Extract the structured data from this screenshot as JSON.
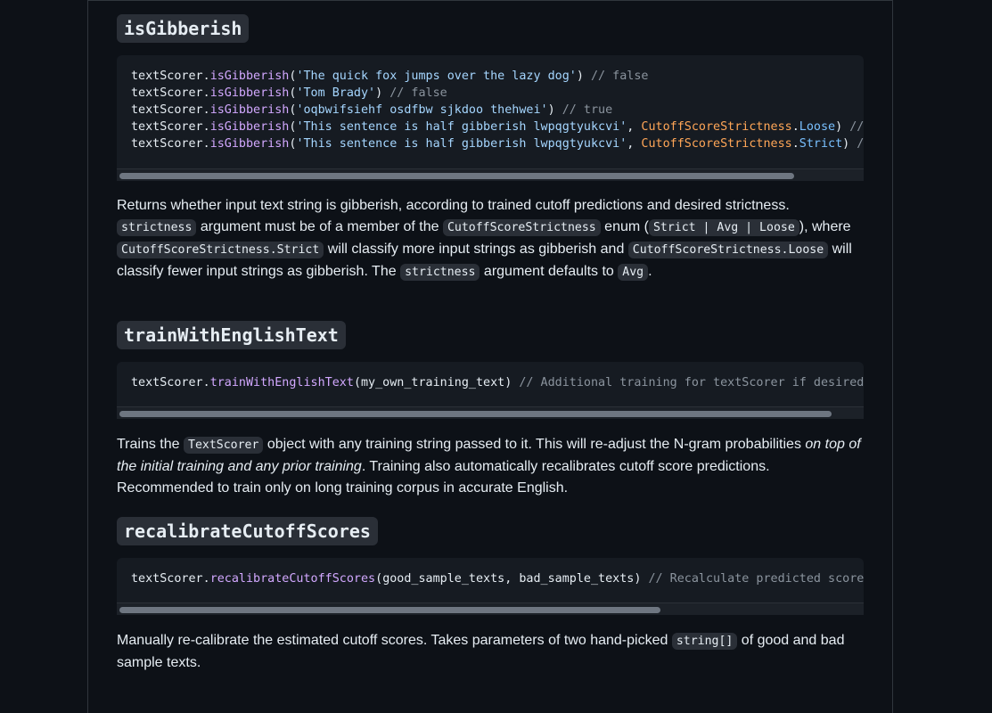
{
  "sections": [
    {
      "heading": "isGibberish",
      "code_lines": [
        {
          "obj": "textScorer",
          "dot": ".",
          "fn": "isGibberish",
          "open": "(",
          "arg": "'The quick fox jumps over the lazy dog'",
          "close": ")",
          "comment": " // false"
        },
        {
          "obj": "textScorer",
          "dot": ".",
          "fn": "isGibberish",
          "open": "(",
          "arg": "'Tom Brady'",
          "close": ")",
          "comment": " // false"
        },
        {
          "obj": "textScorer",
          "dot": ".",
          "fn": "isGibberish",
          "open": "(",
          "arg": "'oqbwifsiehf osdfbw sjkdoo thehwei'",
          "close": ")",
          "comment": " // true"
        },
        {
          "obj": "textScorer",
          "dot": ".",
          "fn": "isGibberish",
          "open": "(",
          "arg": "'This sentence is half gibberish lwpqgtyukcvi'",
          "sep": ", ",
          "cls": "CutoffScoreStrictness",
          "dot2": ".",
          "prop": "Loose",
          "close": ")",
          "comment": " // true"
        },
        {
          "obj": "textScorer",
          "dot": ".",
          "fn": "isGibberish",
          "open": "(",
          "arg": "'This sentence is half gibberish lwpqgtyukcvi'",
          "sep": ", ",
          "cls": "CutoffScoreStrictness",
          "dot2": ".",
          "prop": "Strict",
          "close": ")",
          "comment": " // false"
        }
      ],
      "scroll_fraction": 0.91,
      "paragraph": {
        "t1": "Returns whether input text string is gibberish, according to trained cutoff predictions and desired strictness. ",
        "c1": "strictness",
        "t2": " argument must be of a member of the ",
        "c2": "CutoffScoreStrictness",
        "t3": " enum (",
        "c3": "Strict | Avg | Loose",
        "t4": "), where ",
        "c4": "CutoffScoreStrictness.Strict",
        "t5": " will classify more input strings as gibberish and ",
        "c5": "CutoffScoreStrictness.Loose",
        "t6": " will classify fewer input strings as gibberish. The ",
        "c6": "strictness",
        "t7": " argument defaults to ",
        "c7": "Avg",
        "t8": "."
      }
    },
    {
      "heading": "trainWithEnglishText",
      "code_lines": [
        {
          "obj": "textScorer",
          "dot": ".",
          "fn": "trainWithEnglishText",
          "open": "(",
          "plain": "my_own_training_text",
          "close": ")",
          "comment": " // Additional training for textScorer if desired"
        }
      ],
      "scroll_fraction": 0.96,
      "paragraph": {
        "t1": "Trains the ",
        "c1": "TextScorer",
        "t2": " object with any training string passed to it. This will re-adjust the N-gram probabilities ",
        "em": "on top of the initial training and any prior training",
        "t3": ". Training also automatically recalibrates cutoff score predictions. Recommended to train only on long training corpus in accurate English."
      }
    },
    {
      "heading": "recalibrateCutoffScores",
      "code_lines": [
        {
          "obj": "textScorer",
          "dot": ".",
          "fn": "recalibrateCutoffScores",
          "open": "(",
          "plain": "good_sample_texts, bad_sample_texts",
          "close": ")",
          "comment": " // Recalculate predicted scores"
        }
      ],
      "scroll_fraction": 0.73,
      "paragraph": {
        "t1": "Manually re-calibrate the estimated cutoff scores. Takes parameters of two hand-picked ",
        "c1": "string[]",
        "t2": " of good and bad sample texts."
      }
    }
  ],
  "colors": {
    "background": "#0d1117",
    "code_background": "#161b22",
    "function": "#d2a8ff",
    "string": "#a5d6ff",
    "comment": "#8b949e",
    "class": "#ffa657",
    "property": "#79c0ff"
  }
}
